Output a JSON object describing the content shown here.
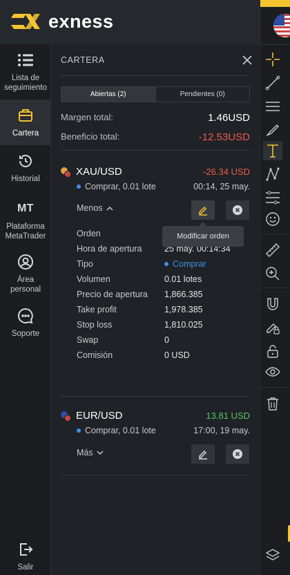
{
  "brand": {
    "name": "exness",
    "accent": "#f4c431"
  },
  "nav": {
    "watchlist": "Lista de seguimiento",
    "portfolio": "Cartera",
    "history": "Historial",
    "mt_short": "MT",
    "platform": "Plataforma MetaTrader",
    "personal": "Área personal",
    "support": "Soporte",
    "exit": "Salir"
  },
  "panel": {
    "title": "CARTERA",
    "tabs": {
      "open": "Abiertas (2)",
      "pending": "Pendientes (0)"
    },
    "margin_label": "Margen total:",
    "margin_value": "1.46USD",
    "profit_label": "Beneficio total:",
    "profit_value": "-12.53USD"
  },
  "positions": [
    {
      "symbol": "XAU/USD",
      "pl": "-26.34 USD",
      "direction": "Comprar, 0.01 lote",
      "time": "00:14, 25 may.",
      "toggle": "Menos",
      "details": {
        "order_label": "Orden",
        "open_time_label": "Hora de apertura",
        "open_time_value": "25 may. 00:14:34",
        "type_label": "Tipo",
        "type_value": "Comprar",
        "volume_label": "Volumen",
        "volume_value": "0.01 lotes",
        "open_price_label": "Precio de apertura",
        "open_price_value": "1,866.385",
        "tp_label": "Take profit",
        "tp_value": "1,978.385",
        "sl_label": "Stop loss",
        "sl_value": "1,810.025",
        "swap_label": "Swap",
        "swap_value": "0",
        "commission_label": "Comisión",
        "commission_value": "0 USD"
      },
      "tooltip": "Modificar orden"
    },
    {
      "symbol": "EUR/USD",
      "pl": "13.81 USD",
      "direction": "Comprar, 0.01 lote",
      "time": "17:00, 19 may.",
      "toggle": "Más"
    }
  ],
  "colors": {
    "negative": "#ee5a4f",
    "positive": "#57c46b",
    "buy": "#3f8fe6"
  }
}
